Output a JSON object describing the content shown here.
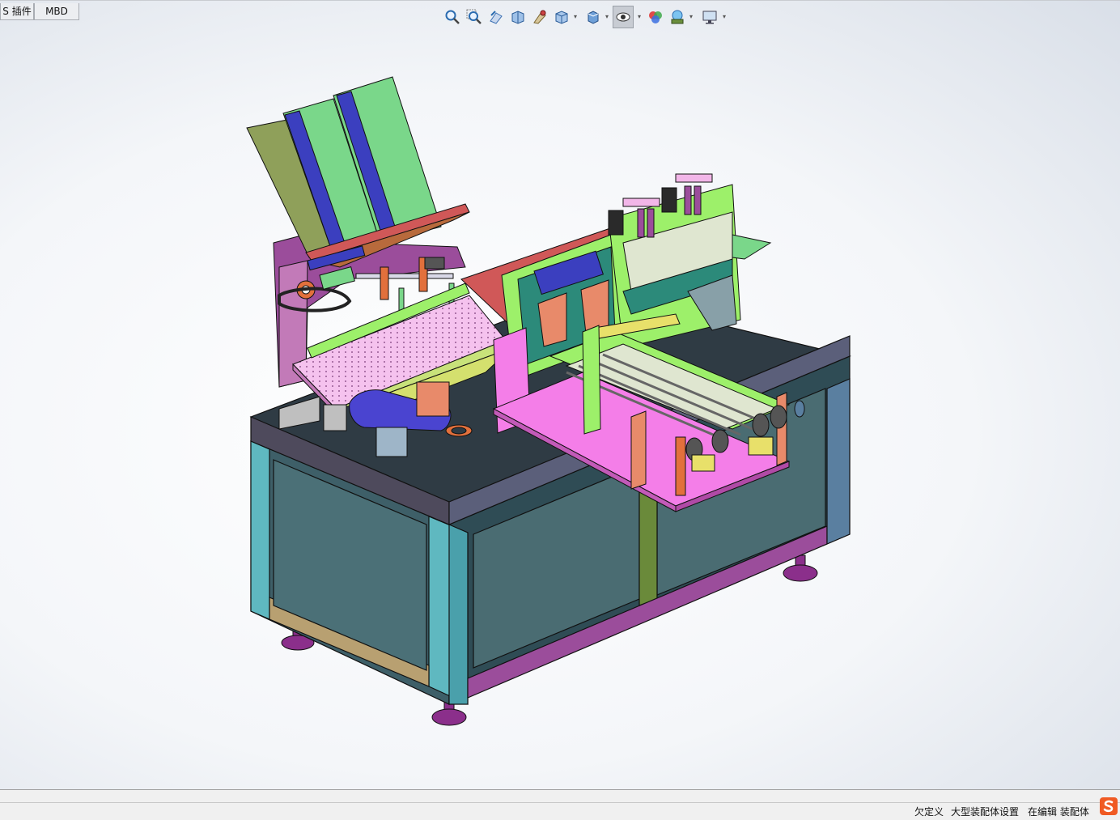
{
  "tabs": [
    {
      "label": "S 插件",
      "active": false
    },
    {
      "label": "MBD",
      "active": false
    }
  ],
  "heads_up_toolbar": {
    "buttons": [
      {
        "name": "zoom-to-fit-icon"
      },
      {
        "name": "zoom-to-area-icon"
      },
      {
        "name": "previous-view-icon"
      },
      {
        "name": "section-view-icon"
      },
      {
        "name": "dynamic-annotation-icon"
      },
      {
        "name": "view-orientation-icon"
      },
      {
        "name": "display-style-icon"
      },
      {
        "name": "hide-show-items-icon"
      },
      {
        "name": "edit-appearance-icon"
      },
      {
        "name": "apply-scene-icon"
      },
      {
        "name": "view-settings-icon"
      }
    ]
  },
  "statusbar": {
    "definition_state": "欠定义",
    "large_assembly": "大型装配体设置",
    "editing": "在编辑 装配体"
  },
  "tray": {
    "ime_icon": "sogou-ime-icon"
  },
  "colors": {
    "viewport_bg": "#f4f6f9",
    "table_top": "#2f3b44",
    "cabinet_panel": "#3e5f68",
    "cabinet_frame": "#5fb8c0",
    "trim_purple": "#9b4d9b",
    "hopper_green": "#7ad78a",
    "hopper_blue": "#3b3fbf",
    "conveyor_pink": "#f2b6e8",
    "carriage_pink": "#f47ee8",
    "frame_lime": "#9df06a",
    "accent_orange": "#e2703c",
    "foot_purple": "#8b2f8b"
  }
}
